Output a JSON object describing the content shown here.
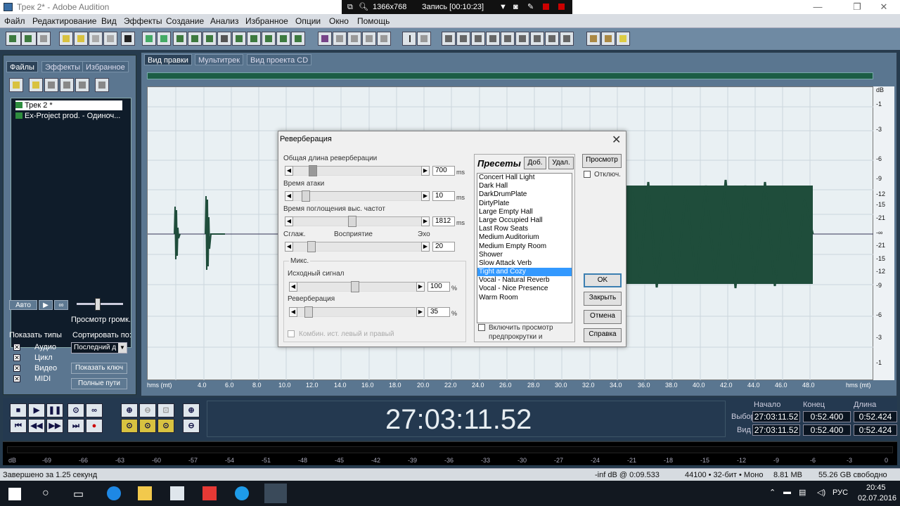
{
  "window": {
    "title": "Трек 2* - Adobe Audition",
    "minimize": "—",
    "maximize": "❐",
    "close": "✕"
  },
  "recorder": {
    "resolution": "1366x768",
    "status": "Запись [00:10:23]"
  },
  "menu": [
    "Файл",
    "Редактирование",
    "Вид",
    "Эффекты",
    "Создание",
    "Анализ",
    "Избранное",
    "Опции",
    "Окно",
    "Помощь"
  ],
  "left_panel": {
    "tabs": [
      "Файлы",
      "Эффекты",
      "Избранное"
    ],
    "files": [
      "Трек 2 *",
      "Ex-Project prod. - Одиноч..."
    ],
    "auto_btn": "Авто",
    "preview_label": "Просмотр громк.",
    "show_types_label": "Показать типы",
    "sort_label": "Сортировать по:",
    "types": [
      "Аудио",
      "Цикл",
      "Видео",
      "MIDI"
    ],
    "sort_value": "Последний д",
    "show_keys_btn": "Показать ключ",
    "full_paths_btn": "Полные пути"
  },
  "view_tabs": [
    "Вид правки",
    "Мультитрек",
    "Вид проекта CD"
  ],
  "db_scale": [
    "dB",
    "-1",
    "-3",
    "-6",
    "-9",
    "-12",
    "-15",
    "-21",
    "-∞",
    "-21",
    "-15",
    "-12",
    "-9",
    "-6",
    "-3",
    "-1"
  ],
  "time_axis": {
    "left_label": "hms (mt)",
    "right_label": "hms (mt)",
    "ticks": [
      "4.0",
      "6.0",
      "8.0",
      "10.0",
      "12.0",
      "14.0",
      "16.0",
      "18.0",
      "20.0",
      "22.0",
      "24.0",
      "26.0",
      "28.0",
      "30.0",
      "32.0",
      "34.0",
      "36.0",
      "38.0",
      "40.0",
      "42.0",
      "44.0",
      "46.0",
      "48.0"
    ]
  },
  "transport": {
    "time": "27:03:11.52",
    "headers": [
      "Начало",
      "Конец",
      "Длина"
    ],
    "rows": [
      {
        "label": "Выбор",
        "values": [
          "27:03:11.52",
          "0:52.400",
          "0:52.424"
        ]
      },
      {
        "label": "Вид",
        "values": [
          "27:03:11.52",
          "0:52.400",
          "0:52.424"
        ]
      }
    ]
  },
  "meter_scale": [
    "dB",
    "-69",
    "-66",
    "-63",
    "-60",
    "-57",
    "-54",
    "-51",
    "-48",
    "-45",
    "-42",
    "-39",
    "-36",
    "-33",
    "-30",
    "-27",
    "-24",
    "-21",
    "-18",
    "-15",
    "-12",
    "-9",
    "-6",
    "-3",
    "0"
  ],
  "status": {
    "left": "Завершено за 1.25 секунд",
    "level": "-inf dB @  0:09.533",
    "format": "44100 • 32-бит • Моно",
    "size": "8.81 MB",
    "free": "55.26 GB свободно"
  },
  "taskbar": {
    "lang": "РУС",
    "time": "20:45",
    "date": "02.07.2016"
  },
  "dialog": {
    "title": "Реверберация",
    "total_length_label": "Общая длина реверберации",
    "total_length_value": "700",
    "attack_label": "Время атаки",
    "attack_value": "10",
    "absorption_label": "Время поглощения выс. частот",
    "absorption_value": "1812",
    "ms": "ms",
    "smooth_label": "Сглаж.",
    "perception_label": "Восприятие",
    "echo_label": "Эхо",
    "perception_value": "20",
    "mix_label": "Микс.",
    "source_label": "Исходный сигнал",
    "source_value": "100",
    "reverb_label": "Реверберация",
    "reverb_value": "35",
    "pct": "%",
    "combine_label": "Комбин. ист. левый и правый",
    "presets_title": "Пресеты",
    "add_btn": "Доб.",
    "del_btn": "Удал.",
    "presets": [
      "Concert Hall Light",
      "Dark Hall",
      "DarkDrumPlate",
      "DirtyPlate",
      "Large Empty Hall",
      "Large Occupied Hall",
      "Last Row Seats",
      "Medium Auditorium",
      "Medium Empty Room",
      "Shower",
      "Slow Attack Verb",
      "Tight and Cozy",
      "Vocal - Natural Reverb",
      "Vocal - Nice Presence",
      "Warm Room"
    ],
    "selected_preset": "Tight and Cozy",
    "preroll_label_1": "Включить просмотр",
    "preroll_label_2": "предпрокрутки и",
    "preview_btn": "Просмотр",
    "bypass_label": "Отключ.",
    "ok_btn": "OK",
    "close_btn": "Закрыть",
    "cancel_btn": "Отмена",
    "help_btn": "Справка"
  }
}
